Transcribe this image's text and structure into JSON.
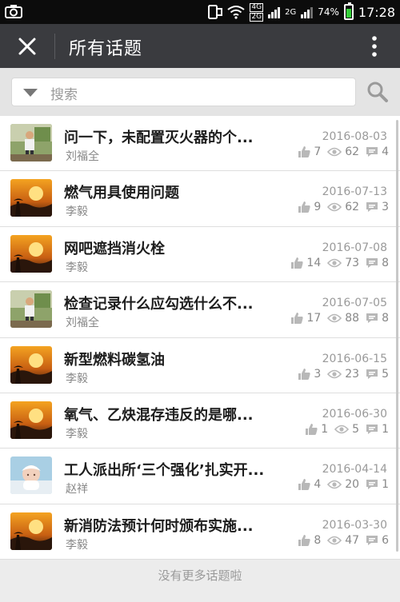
{
  "status_bar": {
    "net_top": "4G",
    "net_bottom": "2G",
    "net2": "2G",
    "battery": "74%",
    "time": "17:28"
  },
  "app_bar": {
    "title": "所有话题"
  },
  "search": {
    "placeholder": "搜索"
  },
  "topics": [
    {
      "title": "问一下，未配置灭火器的个...",
      "author": "刘福全",
      "date": "2016-08-03",
      "likes": "7",
      "views": "62",
      "comments": "4",
      "avatar": "man-standing"
    },
    {
      "title": "燃气用具使用问题",
      "author": "李毅",
      "date": "2016-07-13",
      "likes": "9",
      "views": "62",
      "comments": "3",
      "avatar": "sunset"
    },
    {
      "title": "网吧遮挡消火栓",
      "author": "李毅",
      "date": "2016-07-08",
      "likes": "14",
      "views": "73",
      "comments": "8",
      "avatar": "sunset"
    },
    {
      "title": "检查记录什么应勾选什么不...",
      "author": "刘福全",
      "date": "2016-07-05",
      "likes": "17",
      "views": "88",
      "comments": "8",
      "avatar": "man-standing"
    },
    {
      "title": "新型燃料碳氢油",
      "author": "李毅",
      "date": "2016-06-15",
      "likes": "3",
      "views": "23",
      "comments": "5",
      "avatar": "sunset"
    },
    {
      "title": "氧气、乙炔混存违反的是哪...",
      "author": "李毅",
      "date": "2016-06-30",
      "likes": "1",
      "views": "5",
      "comments": "1",
      "avatar": "sunset"
    },
    {
      "title": "工人派出所‘三个强化’扎实开...",
      "author": "赵祥",
      "date": "2016-04-14",
      "likes": "4",
      "views": "20",
      "comments": "1",
      "avatar": "baby"
    },
    {
      "title": "新消防法预计何时颁布实施...",
      "author": "李毅",
      "date": "2016-03-30",
      "likes": "8",
      "views": "47",
      "comments": "6",
      "avatar": "sunset"
    }
  ],
  "footer": {
    "text": "没有更多话题啦"
  },
  "colors": {
    "app_bar": "#3a3b3f",
    "status_bar": "#0c0c0c",
    "list_bg": "#ffffff",
    "page_bg": "#ececec"
  }
}
